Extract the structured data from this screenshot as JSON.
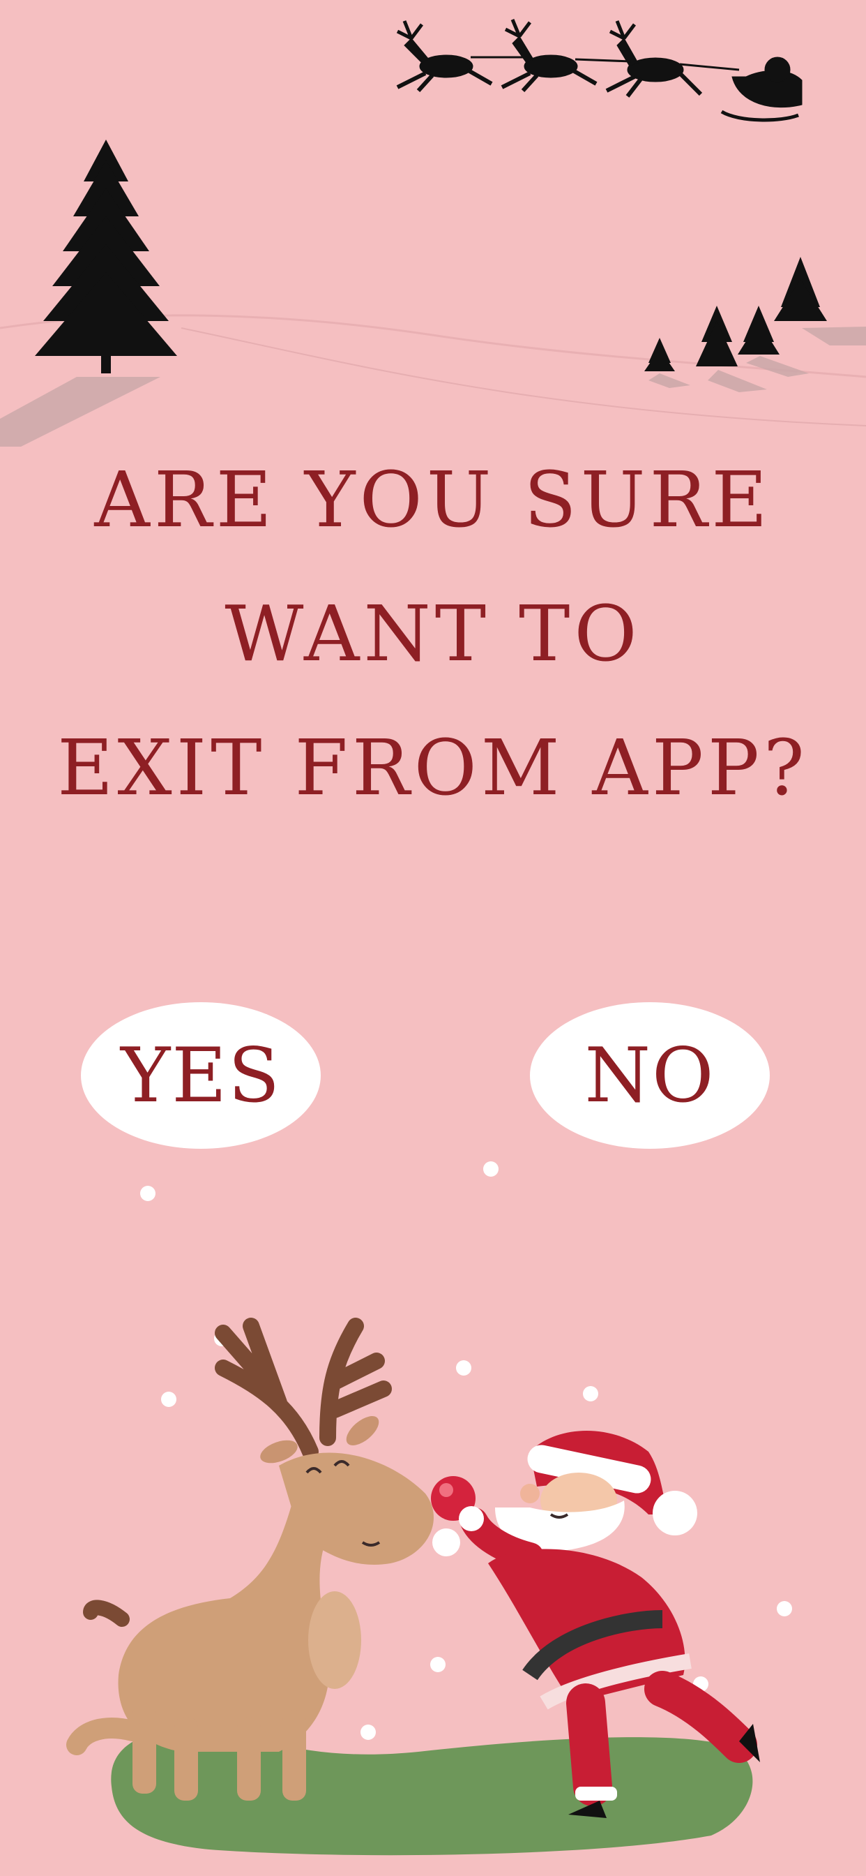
{
  "dialog": {
    "title_lines": [
      "ARE YOU SURE",
      "WANT TO",
      "EXIT FROM APP?"
    ],
    "yes_label": "YES",
    "no_label": "NO"
  },
  "colors": {
    "background": "#f5bfc1",
    "title_text": "#8e1f24",
    "button_fill": "#ffffff"
  },
  "decor": {
    "top_left": "pine-tree-icon",
    "top_right": "santa-sleigh-reindeer-icon",
    "bottom": "santa-with-reindeer-illustration"
  }
}
